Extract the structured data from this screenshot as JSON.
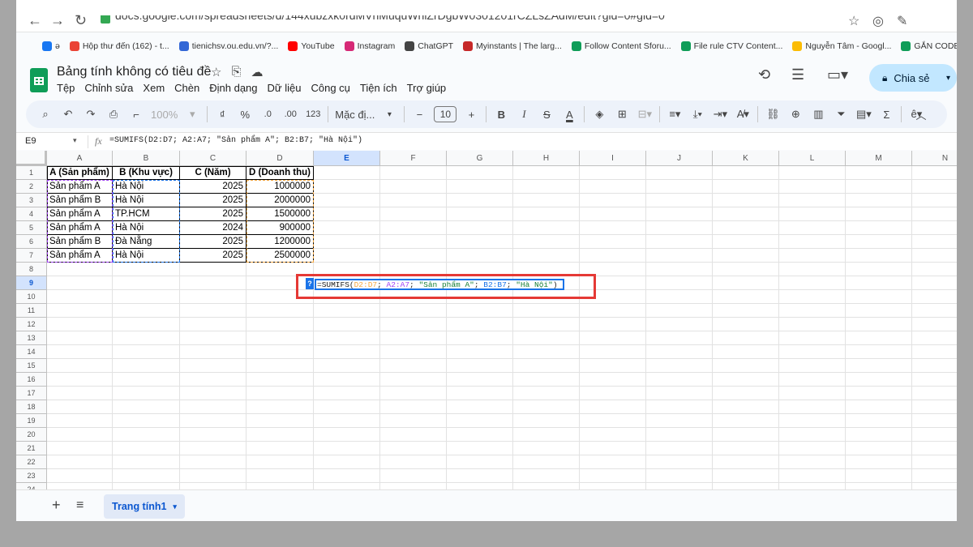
{
  "browser": {
    "url": "docs.google.com/spreadsheets/d/144xubzxk0rdMVhMuquWnlZrDgbW0301201rCZLsZAdM/edit?gid=0#gid=0",
    "bookmarks": [
      {
        "label": "ə",
        "icon": "facebook-icon",
        "color": "#1877f2"
      },
      {
        "label": "Hộp thư đến (162) - t...",
        "icon": "gmail-icon",
        "color": "#ea4335"
      },
      {
        "label": "tienichsv.ou.edu.vn/?...",
        "icon": "link-icon",
        "color": "#3367d6"
      },
      {
        "label": "YouTube",
        "icon": "youtube-icon",
        "color": "#ff0000"
      },
      {
        "label": "Instagram",
        "icon": "instagram-icon",
        "color": "#d62976"
      },
      {
        "label": "ChatGPT",
        "icon": "chatgpt-icon",
        "color": "#444444"
      },
      {
        "label": "Myinstants | The larg...",
        "icon": "myinstants-icon",
        "color": "#c62828"
      },
      {
        "label": "Follow Content Sforu...",
        "icon": "sheets-icon",
        "color": "#0f9d58"
      },
      {
        "label": "File rule CTV Content...",
        "icon": "sheets-icon",
        "color": "#0f9d58"
      },
      {
        "label": "Nguyễn Tâm - Googl...",
        "icon": "drive-icon",
        "color": "#fbbc04"
      },
      {
        "label": "GẮN CODE CÁC BÀI...",
        "icon": "sheets-icon",
        "color": "#0f9d58"
      }
    ]
  },
  "doc": {
    "title": "Bảng tính không có tiêu đề",
    "menus": [
      "Tệp",
      "Chỉnh sửa",
      "Xem",
      "Chèn",
      "Định dạng",
      "Dữ liệu",
      "Công cụ",
      "Tiện ích",
      "Trợ giúp"
    ],
    "share_label": "Chia sẻ"
  },
  "toolbar": {
    "zoom": "100%",
    "currency": "₫",
    "percent": "%",
    "dec_decrease": ".0",
    "dec_increase": ".00",
    "number_format": "123",
    "font": "Mặc đị...",
    "font_size": "10"
  },
  "formula_bar": {
    "cell_ref": "E9",
    "formula": "=SUMIFS(D2:D7; A2:A7; \"Sản phẩm A\"; B2:B7; \"Hà Nội\")"
  },
  "grid": {
    "columns": [
      "A",
      "B",
      "C",
      "D",
      "E",
      "F",
      "G",
      "H",
      "I",
      "J",
      "K",
      "L",
      "M",
      "N"
    ],
    "active_column": "E",
    "active_row": 9,
    "row_count": 24,
    "headers": [
      "A (Sản phẩm)",
      "B (Khu vực)",
      "C (Năm)",
      "D (Doanh thu)"
    ],
    "rows": [
      [
        "Sản phẩm A",
        "Hà Nội",
        "2025",
        "1000000"
      ],
      [
        "Sản phẩm B",
        "Hà Nội",
        "2025",
        "2000000"
      ],
      [
        "Sản phẩm A",
        "TP.HCM",
        "2025",
        "1500000"
      ],
      [
        "Sản phẩm A",
        "Hà Nội",
        "2024",
        "900000"
      ],
      [
        "Sản phẩm B",
        "Đà Nẵng",
        "2025",
        "1200000"
      ],
      [
        "Sản phẩm A",
        "Hà Nội",
        "2025",
        "2500000"
      ]
    ],
    "editing_cell": {
      "parts": [
        {
          "t": "=SUMIFS(",
          "c": "#222222"
        },
        {
          "t": "D2:D7",
          "c": "#f4a742"
        },
        {
          "t": "; ",
          "c": "#222222"
        },
        {
          "t": "A2:A7",
          "c": "#a142f4"
        },
        {
          "t": "; ",
          "c": "#222222"
        },
        {
          "t": "\"Sản phẩm A\"",
          "c": "#188038"
        },
        {
          "t": "; ",
          "c": "#222222"
        },
        {
          "t": "B2:B7",
          "c": "#1a73e8"
        },
        {
          "t": "; ",
          "c": "#222222"
        },
        {
          "t": "\"Hà Nội\"",
          "c": "#188038"
        },
        {
          "t": ")",
          "c": "#222222"
        }
      ],
      "help_icon": "?"
    }
  },
  "sheet_tabs": [
    {
      "label": "Trang tính1",
      "active": true
    }
  ],
  "colors": {
    "accent": "#1a73e8",
    "highlight_box": "#e53935",
    "range_A": "#a142f4",
    "range_B": "#1a73e8",
    "range_D": "#f4a742"
  }
}
